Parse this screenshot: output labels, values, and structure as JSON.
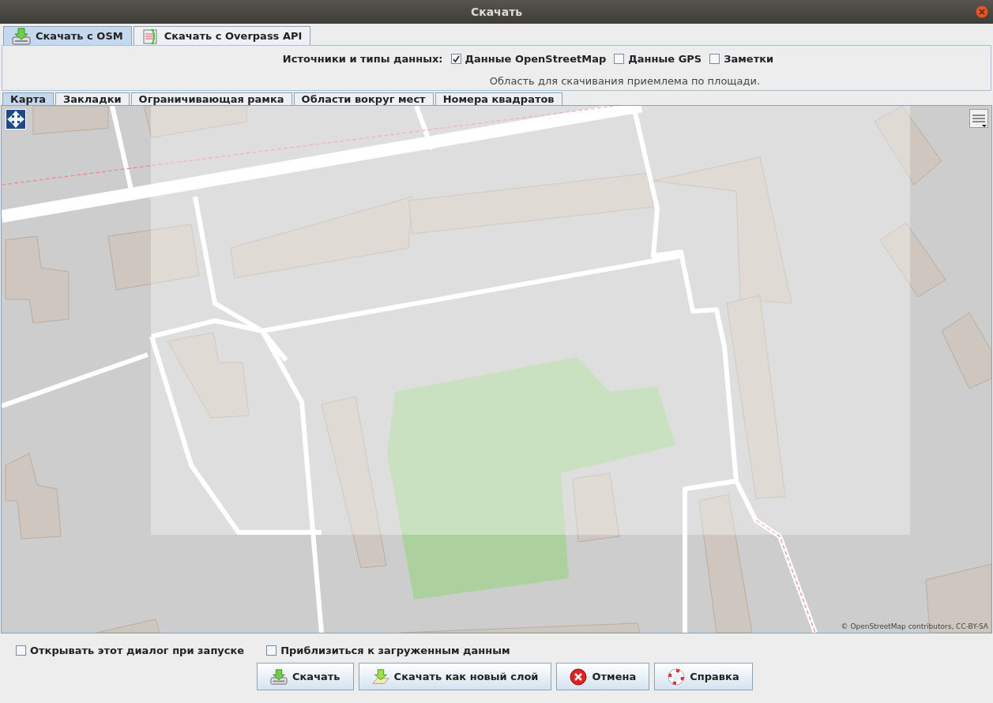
{
  "window": {
    "title": "Скачать"
  },
  "source_tabs": [
    {
      "label": "Скачать с OSM",
      "kind": "osm",
      "selected": true
    },
    {
      "label": "Скачать с Overpass API",
      "kind": "overpass",
      "selected": false
    }
  ],
  "sources": {
    "label": "Источники и типы данных:",
    "options": [
      {
        "label": "Данные OpenStreetMap",
        "checked": true
      },
      {
        "label": "Данные GPS",
        "checked": false
      },
      {
        "label": "Заметки",
        "checked": false
      }
    ]
  },
  "area_status": "Область для скачивания приемлема по площади.",
  "area_tabs": [
    {
      "label": "Карта",
      "selected": true
    },
    {
      "label": "Закладки",
      "selected": false
    },
    {
      "label": "Ограничивающая рамка",
      "selected": false
    },
    {
      "label": "Области вокруг мест",
      "selected": false
    },
    {
      "label": "Номера квадратов",
      "selected": false
    }
  ],
  "map": {
    "attribution": "© OpenStreetMap contributors, CC-BY-SA"
  },
  "options": [
    {
      "label": "Открывать этот диалог при запуске",
      "checked": false
    },
    {
      "label": "Приблизиться к загруженным данным",
      "checked": false
    }
  ],
  "buttons": [
    {
      "label": "Скачать",
      "kind": "download"
    },
    {
      "label": "Скачать как новый слой",
      "kind": "download-layer"
    },
    {
      "label": "Отмена",
      "kind": "cancel"
    },
    {
      "label": "Справка",
      "kind": "help"
    }
  ]
}
